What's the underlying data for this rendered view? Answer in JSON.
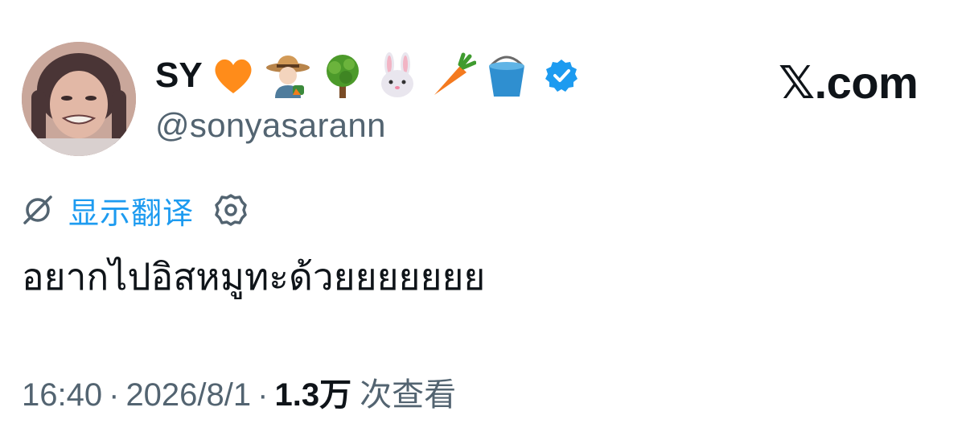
{
  "author": {
    "display_name": "SY",
    "handle": "@sonyasarann",
    "name_emojis": [
      "orange-heart-icon",
      "farmer-icon",
      "tree-icon",
      "rabbit-face-icon",
      "carrot-icon",
      "bucket-icon"
    ],
    "verified_icon": "verified-badge-icon",
    "verified_color": "#1d9bf0"
  },
  "site": {
    "label": "𝕏.com"
  },
  "translate": {
    "icon": "translate-icon",
    "label": "显示翻译",
    "settings_icon": "gear-icon"
  },
  "tweet": {
    "text": "อยากไปอิสหมูทะด้วยยยยยยย"
  },
  "meta": {
    "time": "16:40",
    "separator": "·",
    "date": "2026/8/1",
    "views_count": "1.3",
    "views_unit": "万",
    "views_label": "次查看"
  },
  "colors": {
    "text_primary": "#0f1419",
    "text_secondary": "#536471",
    "accent": "#1d9bf0"
  }
}
